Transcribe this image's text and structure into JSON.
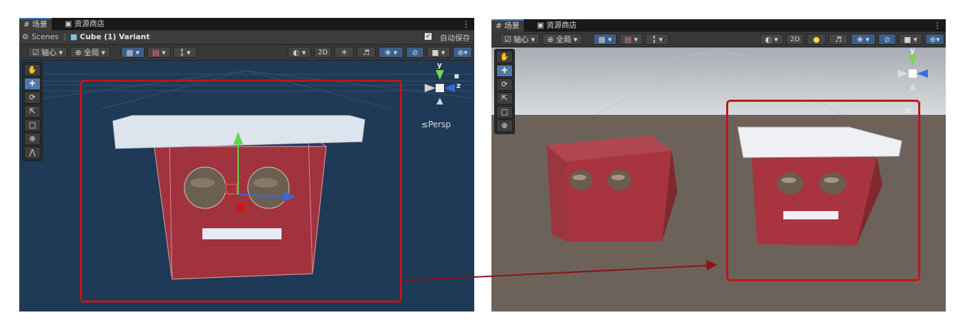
{
  "left_panel": {
    "tabs": [
      {
        "icon": "grid-icon",
        "label": "场景"
      },
      {
        "icon": "bag-icon",
        "label": "资源商店"
      }
    ],
    "breadcrumb": {
      "scenes_label": "Scenes",
      "separator": "|",
      "prefab_label": "Cube (1) Variant",
      "autosave_label": "自动保存",
      "autosave_checked": true
    },
    "toolbar": {
      "pivot_label": "轴心",
      "global_label": "全局",
      "mode_2d_label": "2D"
    },
    "gizmo": {
      "y_label": "y",
      "z_label": "z",
      "persp_label": "≤Persp"
    },
    "tools": [
      "hand",
      "move",
      "rotate",
      "scale",
      "rect",
      "transform",
      "custom"
    ]
  },
  "right_panel": {
    "tabs": [
      {
        "icon": "grid-icon",
        "label": "场景"
      },
      {
        "icon": "bag-icon",
        "label": "资源商店"
      }
    ],
    "toolbar": {
      "pivot_label": "轴心",
      "global_label": "全局",
      "mode_2d_label": "2D"
    },
    "gizmo": {
      "y_label": "y",
      "persp_label": "≤"
    },
    "tools": [
      "hand",
      "move",
      "rotate",
      "scale",
      "rect",
      "transform"
    ]
  },
  "colors": {
    "prefab_bg": "#1f3a57",
    "highlight": "#c01616",
    "cube_red": "#a1333f",
    "lid_white": "#dde4ee",
    "ground": "#6c625a",
    "sky": "#c8ccd0"
  }
}
